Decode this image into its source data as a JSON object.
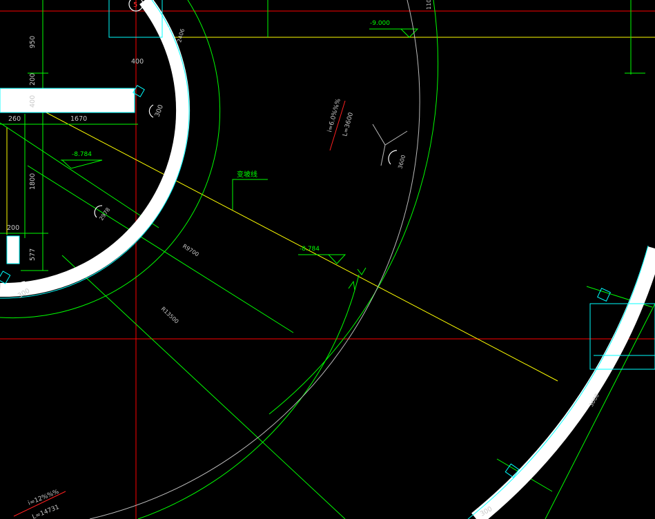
{
  "colors": {
    "background": "#000000",
    "axis_red": "#ff0000",
    "dim_green": "#00ff00",
    "guide_yellow": "#ffff00",
    "outline_cyan": "#00ffff",
    "wall_white": "#ffffff",
    "text_white": "#c8c8c8",
    "label_green": "#00ff00",
    "slope_red": "#ff2020"
  },
  "dimensions": {
    "d950": "950",
    "d200": "200",
    "d400_v": "400",
    "d400_wall": "400",
    "d260": "260",
    "d1670": "1670",
    "d1800": "1800",
    "d200_b": "200",
    "d577": "577",
    "d300_a": "300",
    "d300_b": "300",
    "d300_c": "300",
    "d2406": "2406",
    "d2978": "2978",
    "d110": "110",
    "d3600": "3600",
    "d3000": "3000"
  },
  "radii": {
    "r_inner": "R9700",
    "r_outer": "R13500"
  },
  "elevations": {
    "elev_top": "-9.000",
    "elev_left": "-8.784",
    "elev_mid": "-8.784"
  },
  "labels": {
    "grade_change_line": "变坡线"
  },
  "slopes": {
    "ramp_slope": "i=6.0%%%",
    "ramp_length": "L=3600",
    "outer_slope": "i=12%%%",
    "outer_length": "L=14731"
  },
  "callouts": {
    "tag_top": "5"
  }
}
